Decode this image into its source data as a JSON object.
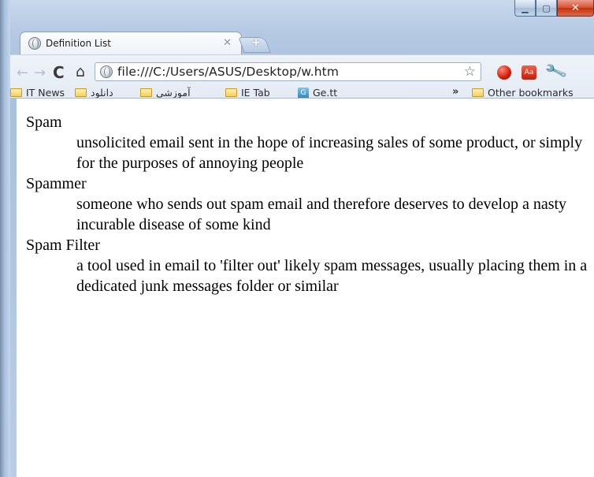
{
  "tab": {
    "title": "Definition List"
  },
  "toolbar": {
    "url": "file:///C:/Users/ASUS/Desktop/w.htm",
    "ext_aa_label": "Aa"
  },
  "bookmarks": {
    "items": [
      "IT News",
      "دانلود",
      "آموزشی",
      "IE Tab",
      "Ge.tt"
    ],
    "overflow": "»",
    "other": "Other bookmarks"
  },
  "definitions": [
    {
      "term": "Spam",
      "description": "unsolicited email sent in the hope of increasing sales of some product, or simply for the purposes of annoying people"
    },
    {
      "term": "Spammer",
      "description": "someone who sends out spam email and therefore deserves to develop a nasty incurable disease of some kind"
    },
    {
      "term": "Spam Filter",
      "description": "a tool used in email to 'filter out' likely spam messages, usually placing them in a dedicated junk messages folder or similar"
    }
  ]
}
